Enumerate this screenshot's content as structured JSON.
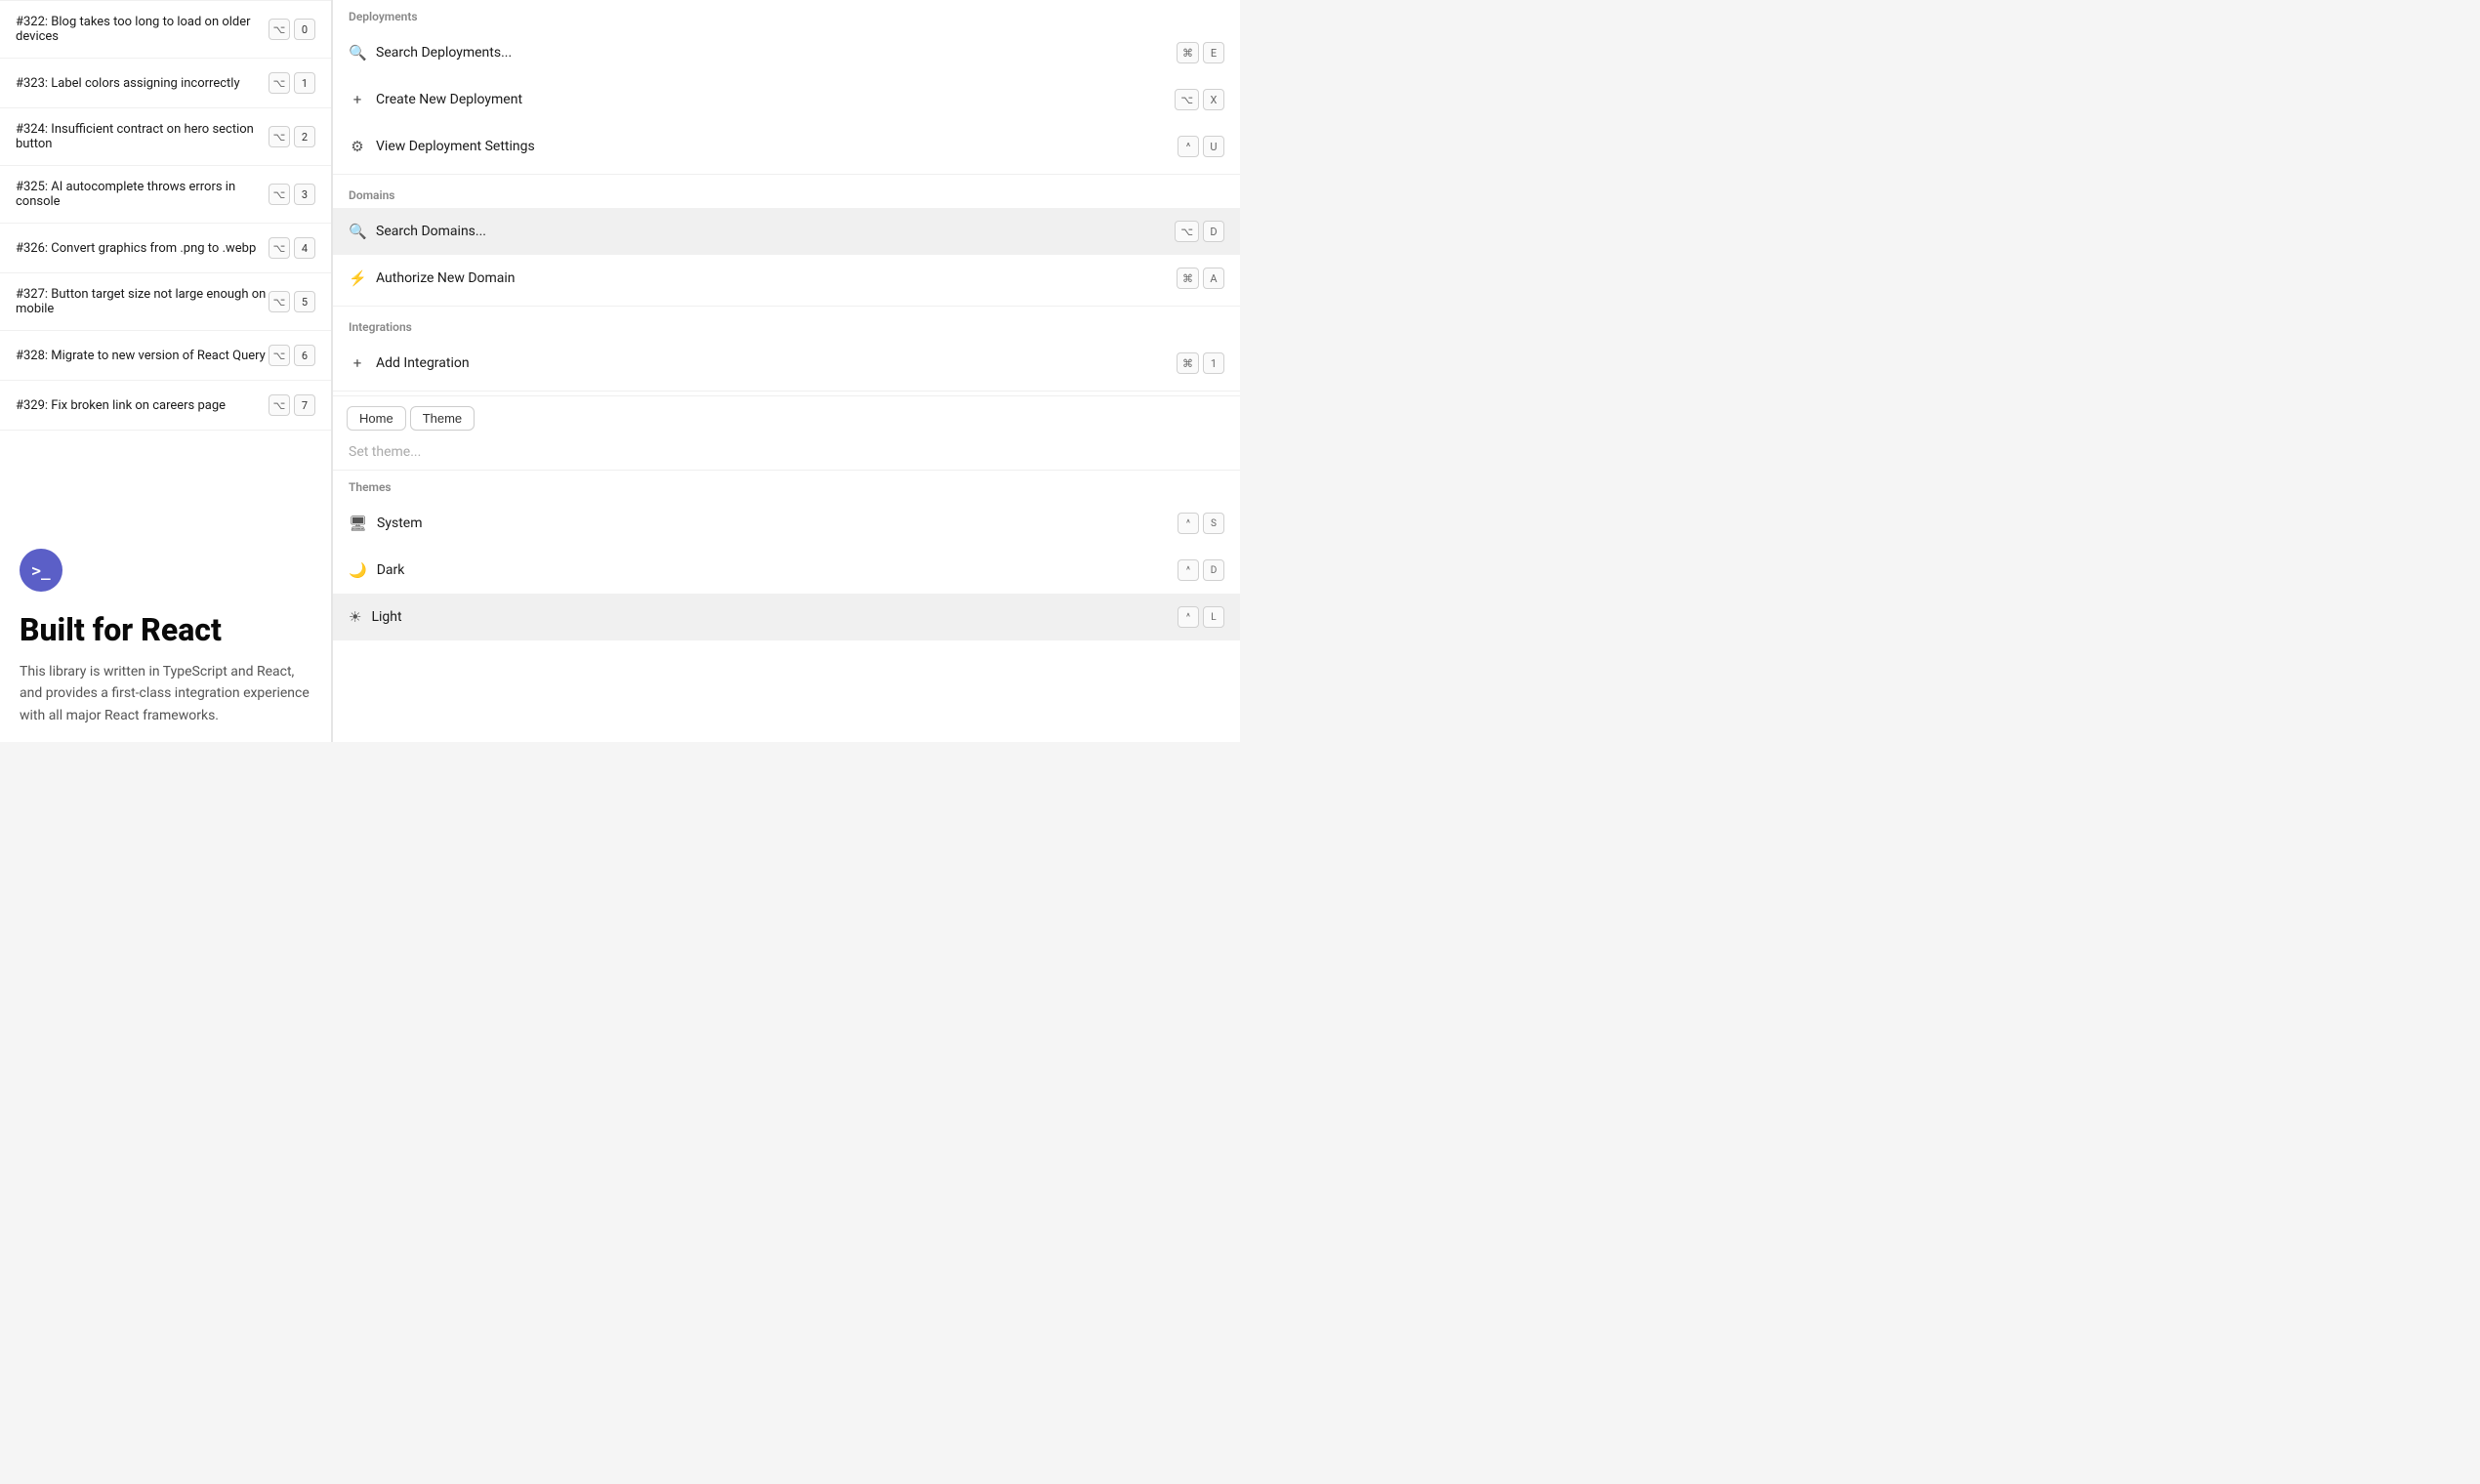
{
  "left": {
    "issues": [
      {
        "id": "#322",
        "label": "#322: Blog takes too long to load on older devices",
        "num": "0"
      },
      {
        "id": "#323",
        "label": "#323: Label colors assigning incorrectly",
        "num": "1"
      },
      {
        "id": "#324",
        "label": "#324: Insufficient contract on hero section button",
        "num": "2"
      },
      {
        "id": "#325",
        "label": "#325: AI autocomplete throws errors in console",
        "num": "3"
      },
      {
        "id": "#326",
        "label": "#326: Convert graphics from .png to .webp",
        "num": "4"
      },
      {
        "id": "#327",
        "label": "#327: Button target size not large enough on mobile",
        "num": "5"
      },
      {
        "id": "#328",
        "label": "#328: Migrate to new version of React Query",
        "num": "6"
      },
      {
        "id": "#329",
        "label": "#329: Fix broken link on careers page",
        "num": "7"
      }
    ],
    "terminal": {
      "icon_label": ">_",
      "title": "Built for React",
      "description": "This library is written in TypeScript and React, and provides a first-class integration experience with all major React frameworks."
    }
  },
  "right": {
    "deployments": {
      "section_label": "Deployments",
      "items": [
        {
          "icon": "search",
          "label": "Search Deployments...",
          "kbd1": "⌘",
          "kbd2": "E"
        },
        {
          "icon": "plus",
          "label": "Create New Deployment",
          "kbd1": "⌥",
          "kbd2": "X"
        },
        {
          "icon": "gear",
          "label": "View Deployment Settings",
          "kbd1": "^",
          "kbd2": "U"
        }
      ]
    },
    "domains": {
      "section_label": "Domains",
      "items": [
        {
          "icon": "search",
          "label": "Search Domains...",
          "kbd1": "⌥",
          "kbd2": "D",
          "highlighted": true
        },
        {
          "icon": "bolt",
          "label": "Authorize New Domain",
          "kbd1": "⌘",
          "kbd2": "A"
        }
      ]
    },
    "integrations": {
      "section_label": "Integrations",
      "items": [
        {
          "icon": "plus",
          "label": "Add Integration",
          "kbd1": "⌘",
          "kbd2": "1"
        }
      ]
    },
    "theme_panel": {
      "tabs": [
        {
          "label": "Home",
          "active": false
        },
        {
          "label": "Theme",
          "active": true
        }
      ],
      "search_placeholder": "Set theme...",
      "themes_label": "Themes",
      "themes": [
        {
          "icon": "monitor",
          "label": "System",
          "kbd1": "^",
          "kbd2": "S"
        },
        {
          "icon": "moon",
          "label": "Dark",
          "kbd1": "^",
          "kbd2": "D"
        },
        {
          "icon": "sun",
          "label": "Light",
          "kbd1": "^",
          "kbd2": "L",
          "selected": true
        }
      ]
    }
  }
}
